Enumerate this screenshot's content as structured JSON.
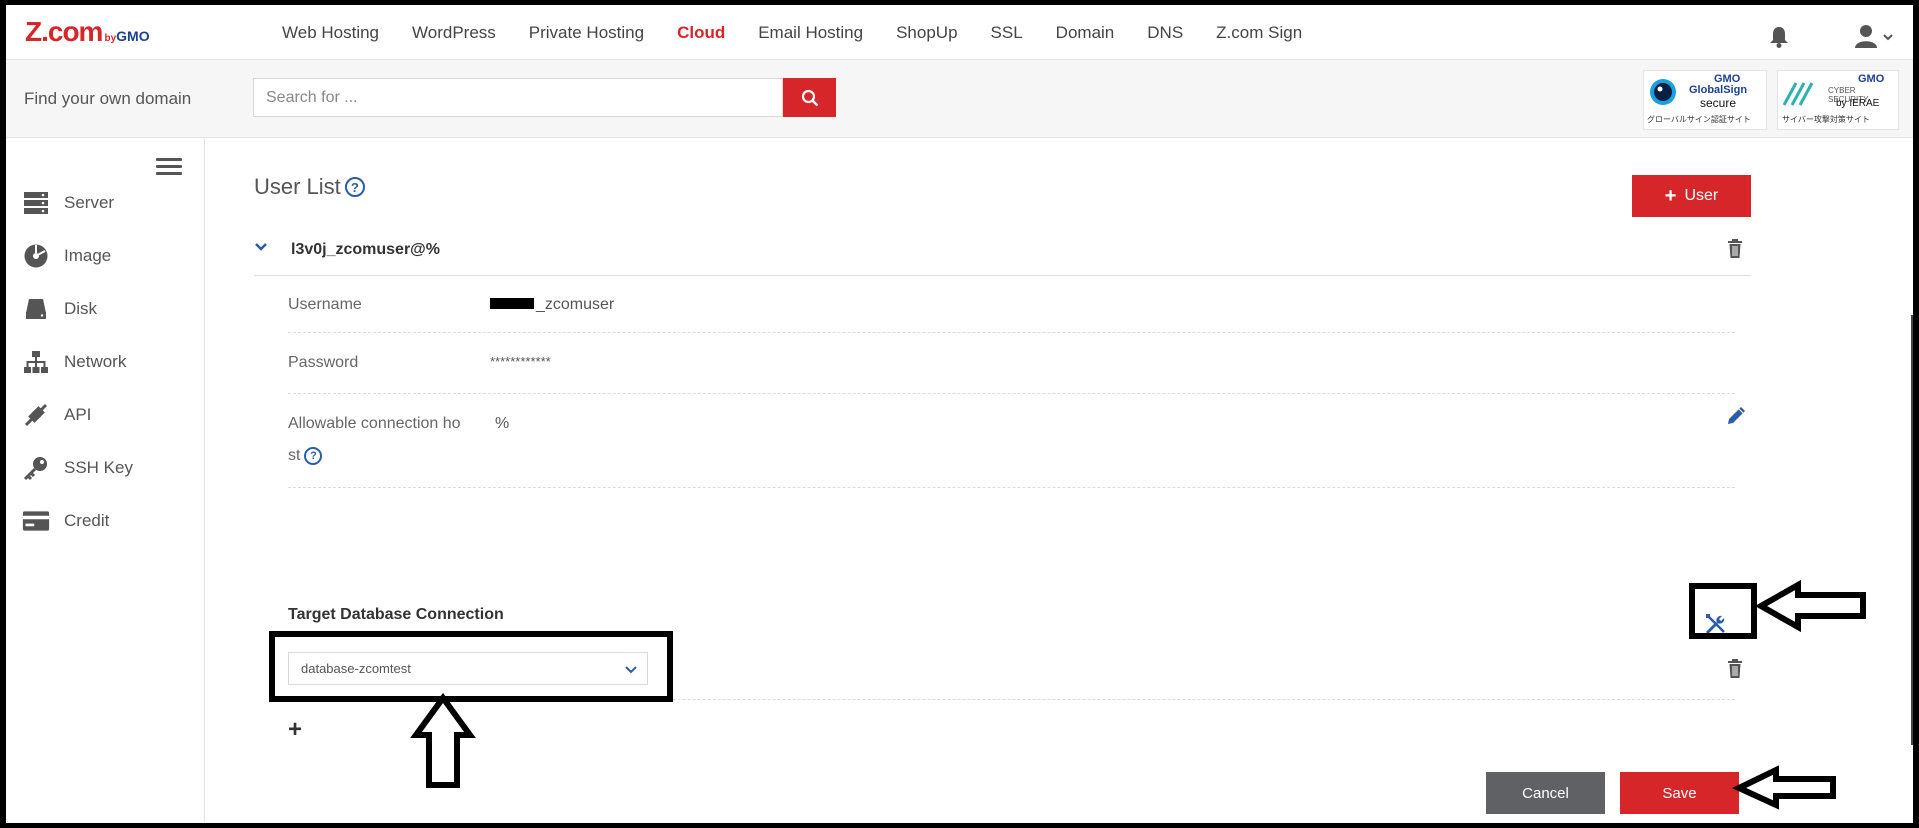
{
  "brand": {
    "logo_main": "Z.com",
    "logo_by": "by",
    "logo_gmo": "GMO"
  },
  "topnav": {
    "items": [
      {
        "label": "Web Hosting"
      },
      {
        "label": "WordPress"
      },
      {
        "label": "Private Hosting"
      },
      {
        "label": "Cloud",
        "active": true
      },
      {
        "label": "Email Hosting"
      },
      {
        "label": "ShopUp"
      },
      {
        "label": "SSL"
      },
      {
        "label": "Domain"
      },
      {
        "label": "DNS"
      },
      {
        "label": "Z.com Sign"
      }
    ],
    "bell_icon": "bell-icon",
    "user_icon": "user-icon"
  },
  "search": {
    "label": "Find your own domain",
    "placeholder": "Search for ...",
    "button_icon": "search-icon"
  },
  "badges": {
    "globalsign": {
      "line1": "GMO",
      "line2": "GlobalSign",
      "line3": "secure",
      "line4": "グローバルサイン認証サイト"
    },
    "cybersecurity": {
      "line1": "GMO",
      "line2": "CYBER SECURITY",
      "line3": "by IERAE",
      "line4": "サイバー攻撃対策サイト"
    }
  },
  "sidebar": {
    "items": [
      {
        "label": "Server",
        "icon": "server-icon"
      },
      {
        "label": "Image",
        "icon": "image-icon"
      },
      {
        "label": "Disk",
        "icon": "disk-icon"
      },
      {
        "label": "Network",
        "icon": "network-icon"
      },
      {
        "label": "API",
        "icon": "api-icon"
      },
      {
        "label": "SSH Key",
        "icon": "key-icon"
      },
      {
        "label": "Credit",
        "icon": "credit-card-icon"
      }
    ]
  },
  "main": {
    "title": "User List",
    "help": "?",
    "add_user_label": "User",
    "user": {
      "name": "l3v0j_zcomuser@%",
      "fields": {
        "username_label": "Username",
        "username_value": "_zcomuser",
        "password_label": "Password",
        "password_value": "************",
        "host_label_1": "Allowable connection ho",
        "host_label_2": "st",
        "host_value": "%"
      }
    },
    "db_section": {
      "title": "Target Database Connection",
      "selected": "database-zcomtest",
      "add": "+"
    },
    "buttons": {
      "cancel": "Cancel",
      "save": "Save"
    }
  },
  "colors": {
    "accent": "#d6262a",
    "link": "#2a5caa",
    "cancel": "#5f6164"
  }
}
